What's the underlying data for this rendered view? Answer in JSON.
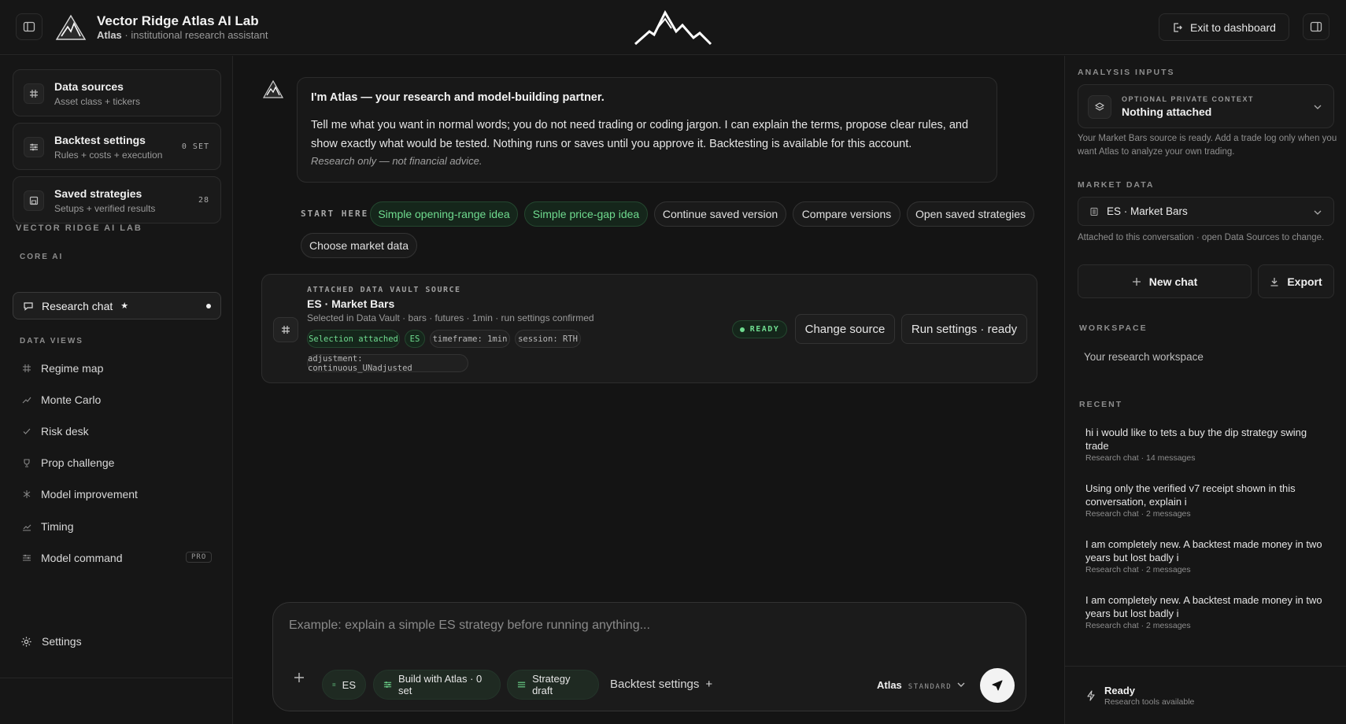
{
  "header": {
    "title": "Vector Ridge Atlas AI Lab",
    "subtitle_brand": "Atlas",
    "subtitle_rest": " · institutional research assistant",
    "exit_label": "Exit to dashboard"
  },
  "sidebar": {
    "cards": [
      {
        "title": "Data sources",
        "sub": "Asset class + tickers",
        "badge": "",
        "icon": "hash-icon"
      },
      {
        "title": "Backtest settings",
        "sub": "Rules + costs + execution",
        "badge": "0 SET",
        "icon": "sliders-icon"
      },
      {
        "title": "Saved strategies",
        "sub": "Setups + verified results",
        "badge": "28",
        "icon": "save-icon"
      }
    ],
    "org_label": "VECTOR RIDGE AI LAB",
    "core_label": "CORE AI",
    "active_item": "Research chat",
    "active_star": "★",
    "data_views_label": "DATA VIEWS",
    "items": [
      "Regime map",
      "Monte Carlo",
      "Risk desk",
      "Prop challenge",
      "Model improvement",
      "Timing",
      "Model command"
    ],
    "pro_badge": "PRO",
    "settings_label": "Settings"
  },
  "chat": {
    "greeting": "I'm Atlas — your research and model-building partner.",
    "body": "Tell me what you want in normal words; you do not need trading or coding jargon. I can explain the terms, propose clear rules, and show exactly what would be tested. Nothing runs or saves until you approve it. Backtesting is available for this account.",
    "disclaimer": "Research only — not financial advice.",
    "start_label": "START HERE",
    "chips": [
      "Simple opening-range idea",
      "Simple price-gap idea",
      "Continue saved version",
      "Compare versions",
      "Open saved strategies",
      "Choose market data"
    ]
  },
  "source": {
    "label": "ATTACHED DATA VAULT SOURCE",
    "title": "ES · Market Bars",
    "sub": "Selected in Data Vault · bars · futures · 1min · run settings confirmed",
    "tags": [
      "Selection attached",
      "ES",
      "timeframe: 1min",
      "session: RTH",
      "adjustment: continuous_UNadjusted"
    ],
    "status": "READY",
    "change_label": "Change source",
    "run_label": "Run settings · ready"
  },
  "composer": {
    "placeholder": "Example: explain a simple ES strategy before running anything...",
    "chips": [
      "ES",
      "Build with Atlas · 0 set",
      "Strategy draft"
    ],
    "backtest_label": "Backtest settings",
    "backtest_plus": "+",
    "model_name": "Atlas",
    "model_tier": "STANDARD"
  },
  "right": {
    "inputs_label": "ANALYSIS INPUTS",
    "context_label": "OPTIONAL PRIVATE CONTEXT",
    "context_value": "Nothing attached",
    "context_note": "Your Market Bars source is ready. Add a trade log only when you want Atlas to analyze your own trading.",
    "market_label": "MARKET DATA",
    "market_value": "ES · Market Bars",
    "market_note": "Attached to this conversation · open Data Sources to change.",
    "new_chat": "New chat",
    "export": "Export",
    "workspace_label": "WORKSPACE",
    "workspace_value": "Your research workspace",
    "recent_label": "RECENT",
    "recent": [
      {
        "title": "hi i would like to tets a buy the dip strategy swing trade",
        "meta": "Research chat · 14 messages"
      },
      {
        "title": "Using only the verified v7 receipt shown in this conversation, explain i",
        "meta": "Research chat · 2 messages"
      },
      {
        "title": "I am completely new. A backtest made money in two years but lost badly i",
        "meta": "Research chat · 2 messages"
      },
      {
        "title": "I am completely new. A backtest made money in two years but lost badly i",
        "meta": "Research chat · 2 messages"
      }
    ],
    "status_title": "Ready",
    "status_sub": "Research tools available"
  }
}
